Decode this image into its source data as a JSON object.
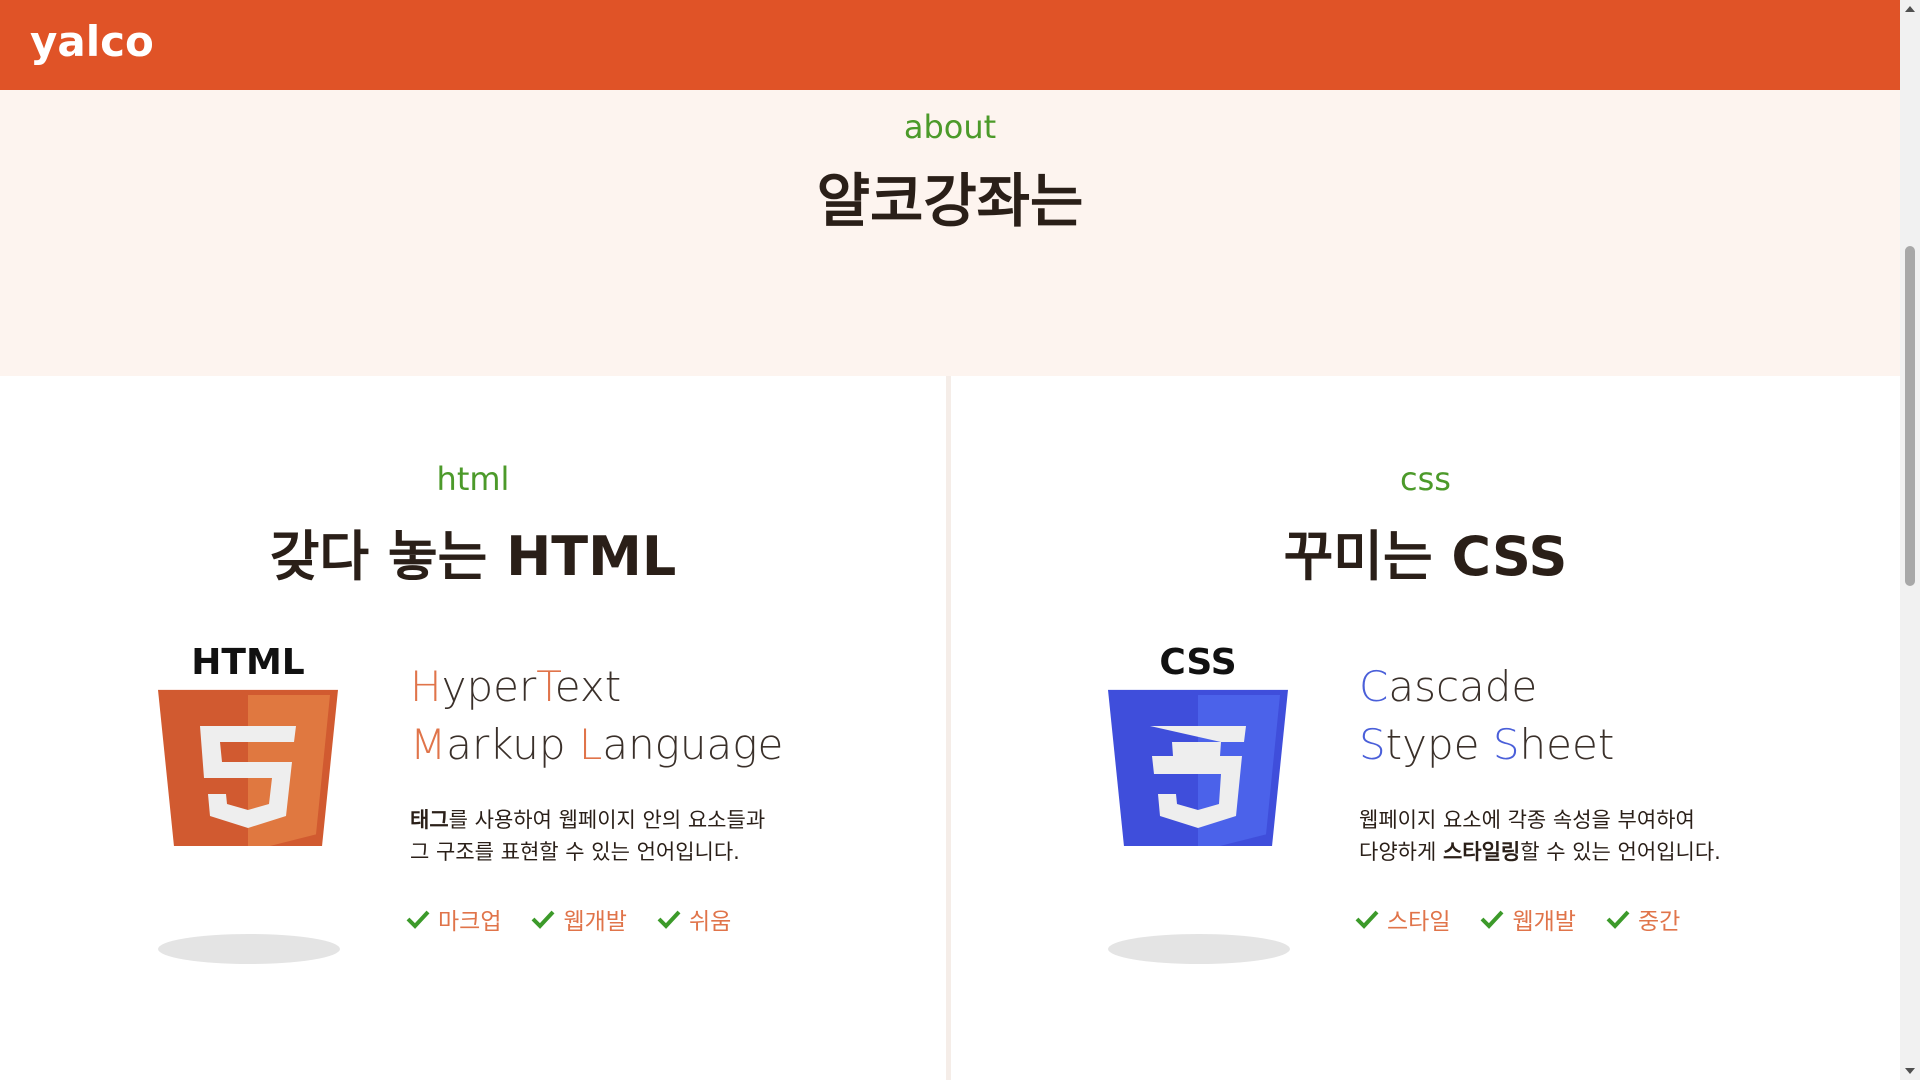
{
  "header": {
    "logo_text": "yalco",
    "bg_color": "#e05327"
  },
  "about": {
    "kicker": "about",
    "title": "얄코강좌는"
  },
  "html_panel": {
    "kicker": "html",
    "title": "갖다 놓는 HTML",
    "badge_label": "HTML",
    "badge_digit": "5",
    "acronym": [
      {
        "hl": "H",
        "rest": "yper"
      },
      {
        "hl": "T",
        "rest": "ext"
      },
      {
        "hl": "M",
        "rest": "arkup "
      },
      {
        "hl": "L",
        "rest": "anguage"
      }
    ],
    "desc": {
      "bold": "태그",
      "line1_rest": "를 사용하여 웹페이지 안의 요소들과",
      "line2": "그 구조를 표현할 수 있는 언어입니다."
    },
    "tags": [
      "마크업",
      "웹개발",
      "쉬움"
    ],
    "accent": "#e0744a"
  },
  "css_panel": {
    "kicker": "css",
    "title": "꾸미는 CSS",
    "badge_label": "CSS",
    "badge_digit": "3",
    "acronym": [
      {
        "hl": "C",
        "rest": "ascade"
      },
      {
        "hl": "S",
        "rest": "type "
      },
      {
        "hl": "S",
        "rest": "heet"
      }
    ],
    "desc": {
      "line1": "웹페이지 요소에 각종 속성을 부여하여",
      "line2_pre": "다양하게 ",
      "bold": "스타일링",
      "line2_rest": "할 수 있는 언어입니다."
    },
    "tags": [
      "스타일",
      "웹개발",
      "중간"
    ],
    "accent": "#4a5fd9"
  }
}
